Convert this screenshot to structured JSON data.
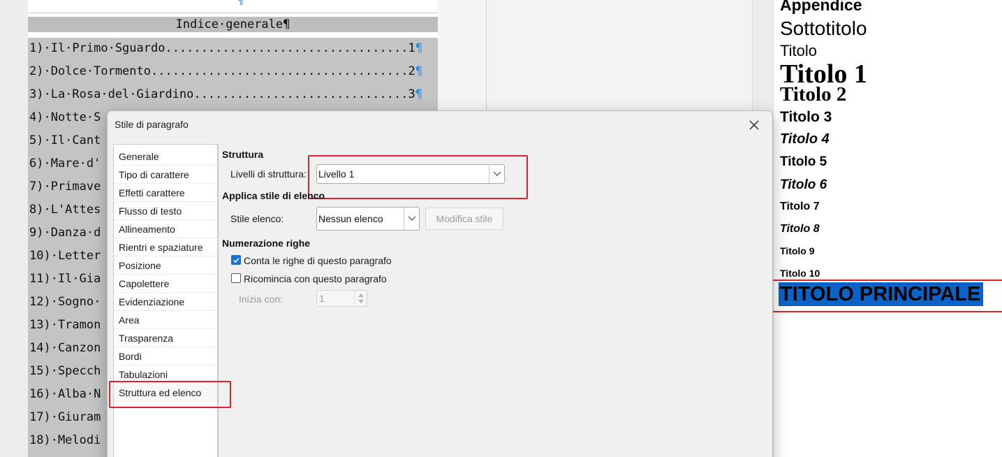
{
  "document": {
    "top_pilcrow": "¶",
    "toc_title": "Indice·generale¶",
    "toc_entries": [
      "1)·Il·Primo·Sguardo..................................1",
      "2)·Dolce·Tormento....................................2",
      "3)·La·Rosa·del·Giardino..............................3",
      "4)·Notte·S",
      "5)·Il·Cant",
      "6)·Mare·d'",
      "7)·Primave",
      "8)·L'Attes",
      "9)·Danza·d",
      "10)·Letter",
      "11)·Il·Gia",
      "12)·Sogno·",
      "13)·Tramon",
      "14)·Canzon",
      "15)·Specch",
      "16)·Alba·N",
      "17)·Giuram",
      "18)·Melodi"
    ],
    "pilcrow": "¶"
  },
  "styles_panel": {
    "items": [
      {
        "label": "Appendice"
      },
      {
        "label": "Sottotitolo"
      },
      {
        "label": "Titolo"
      },
      {
        "label": "Titolo 1"
      },
      {
        "label": "Titolo 2"
      },
      {
        "label": "Titolo 3"
      },
      {
        "label": "Titolo 4"
      },
      {
        "label": "Titolo 5"
      },
      {
        "label": "Titolo 6"
      },
      {
        "label": "Titolo 7"
      },
      {
        "label": "Titolo 8"
      },
      {
        "label": "Titolo 9"
      },
      {
        "label": "Titolo 10"
      },
      {
        "label": "TITOLO PRINCIPALE"
      }
    ],
    "selected_color": "#0a64c8"
  },
  "dialog": {
    "title": "Stile di paragrafo",
    "tabs": [
      "Generale",
      "Tipo di carattere",
      "Effetti carattere",
      "Flusso di testo",
      "Allineamento",
      "Rientri e spaziature",
      "Posizione",
      "Capolettere",
      "Evidenziazione",
      "Area",
      "Trasparenza",
      "Bordi",
      "Tabulazioni",
      "Struttura ed elenco"
    ],
    "active_tab": "Struttura ed elenco",
    "struttura": {
      "heading": "Struttura",
      "levels_label": "Livelli di struttura:",
      "levels_value": "Livello 1"
    },
    "elenco": {
      "heading": "Applica stile di elenco",
      "list_style_label": "Stile elenco:",
      "list_style_value": "Nessun elenco",
      "edit_style_button": "Modifica stile"
    },
    "numerazione": {
      "heading": "Numerazione righe",
      "count_lines_label": "Conta le righe di questo paragrafo",
      "count_lines_checked": true,
      "restart_label": "Ricomincia con questo paragrafo",
      "restart_checked": false,
      "start_with_label": "Inizia con:",
      "start_with_value": "1"
    }
  },
  "highlight_color": "#e0202a"
}
